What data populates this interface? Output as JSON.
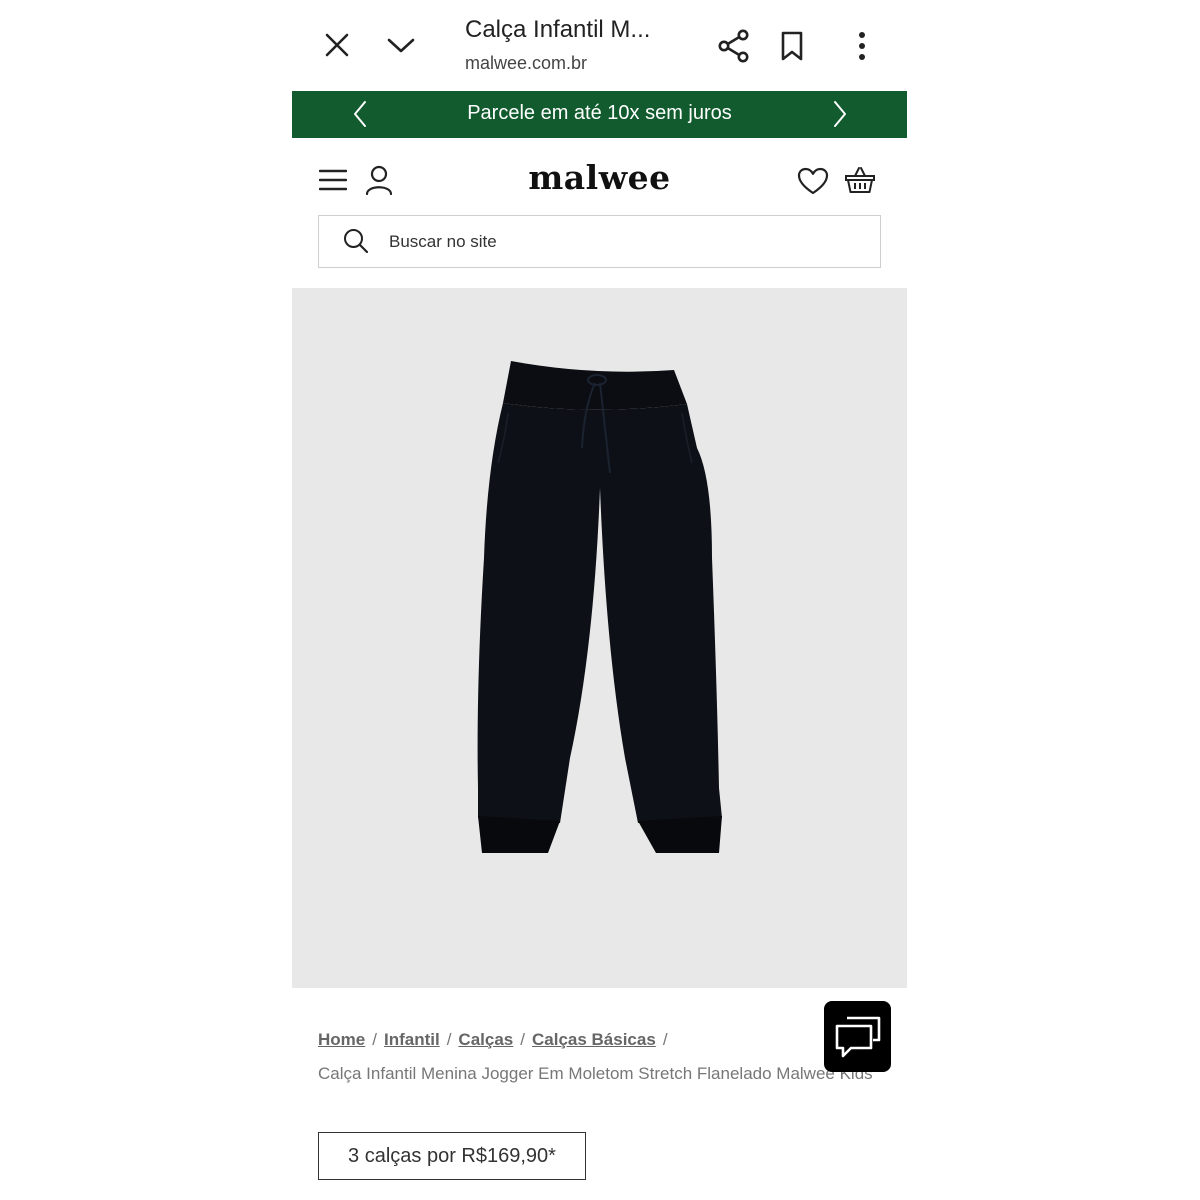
{
  "browser": {
    "title": "Calça Infantil M...",
    "url": "malwee.com.br",
    "icons": [
      "close-icon",
      "chevron-down-icon",
      "share-icon",
      "bookmark-icon",
      "more-vertical-icon"
    ]
  },
  "promo": {
    "text": "Parcele em até 10x sem juros",
    "bg_color": "#115b2e"
  },
  "header": {
    "logo": "malwee",
    "icons": [
      "menu-icon",
      "user-icon",
      "heart-icon",
      "basket-icon"
    ]
  },
  "search": {
    "placeholder": "Buscar no site"
  },
  "breadcrumb": {
    "items": [
      "Home",
      "Infantil",
      "Calças",
      "Calças Básicas"
    ],
    "separator": "/"
  },
  "product": {
    "title": "Calça Infantil Menina Jogger Em Moletom Stretch Flanelado Malwee Kids",
    "promo_label": "3 calças por R$169,90*"
  }
}
